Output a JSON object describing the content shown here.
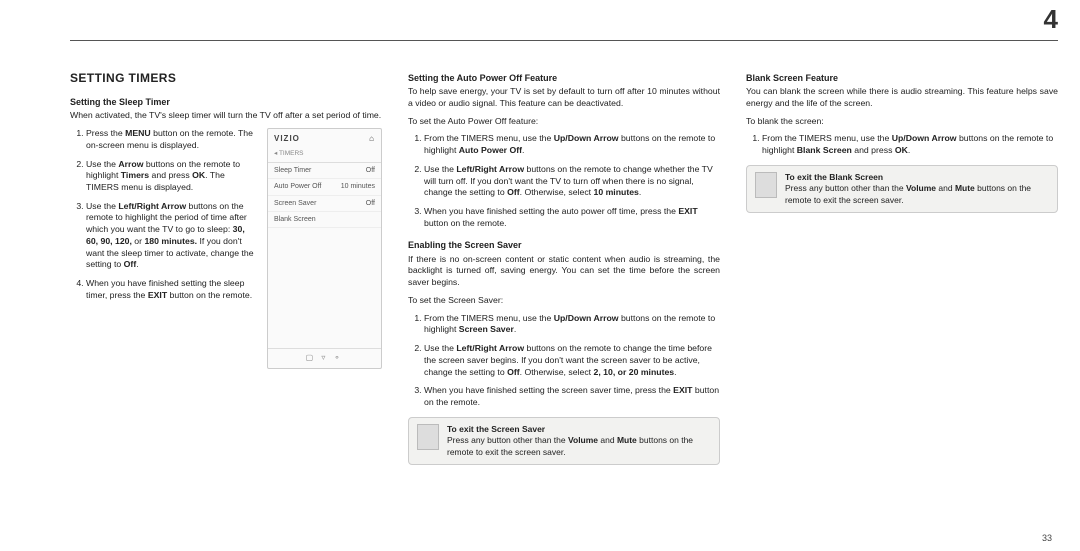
{
  "chapter_number": "4",
  "page_number": "33",
  "section_title": "SETTING TIMERS",
  "col1": {
    "h1": "Setting the Sleep Timer",
    "intro": "When activated, the TV's sleep timer will turn the TV off after a set period of time.",
    "s1a": "Press the ",
    "s1b": "MENU",
    "s1c": " button on the remote. The on-screen menu is displayed.",
    "s2a": "Use the ",
    "s2b": "Arrow",
    "s2c": " buttons on the remote to highlight ",
    "s2d": "Timers",
    "s2e": " and press ",
    "s2f": "OK",
    "s2g": ". The TIMERS menu is displayed.",
    "s3a": "Use the ",
    "s3b": "Left/Right Arrow",
    "s3c": " buttons on the remote to highlight the period of time after which you want the TV to go to sleep: ",
    "s3d": "30, 60, 90, 120,",
    "s3e": " or ",
    "s3f": "180 minutes.",
    "s3g": " If you don't want the sleep timer to activate, change the setting to ",
    "s3h": "Off",
    "s3i": ".",
    "s4a": "When you have finished setting the sleep timer, press the ",
    "s4b": "EXIT",
    "s4c": " button on the remote."
  },
  "osd": {
    "brand": "VIZIO",
    "menu_label": "TIMERS",
    "rows": [
      {
        "label": "Sleep Timer",
        "value": "Off"
      },
      {
        "label": "Auto Power Off",
        "value": "10 minutes"
      },
      {
        "label": "Screen Saver",
        "value": "Off"
      },
      {
        "label": "Blank Screen",
        "value": ""
      }
    ],
    "foot": "▢  ▿  ⚬"
  },
  "col2": {
    "hA": "Setting the Auto Power Off Feature",
    "pA": "To help save energy, your TV is set by default to turn off after 10 minutes without a video or audio signal. This feature can be deactivated.",
    "pA2": "To set the Auto Power Off feature:",
    "a1a": "From the TIMERS menu, use the ",
    "a1b": "Up/Down Arrow",
    "a1c": " buttons on the remote to highlight ",
    "a1d": "Auto Power Off",
    "a1e": ".",
    "a2a": "Use the ",
    "a2b": "Left/Right Arrow",
    "a2c": " buttons on the remote to change whether the TV will turn off. If you don't want the TV to turn off when there is no signal, change the setting to ",
    "a2d": "Off",
    "a2e": ". Otherwise, select ",
    "a2f": "10 minutes",
    "a2g": ".",
    "a3a": "When you have finished setting the auto power off time, press the ",
    "a3b": "EXIT",
    "a3c": " button on the remote.",
    "hB": "Enabling the Screen Saver",
    "pB": "If there is no on-screen content or static content when audio is streaming, the backlight is turned off, saving energy. You can set the time before the screen saver begins.",
    "pB2": "To set the Screen Saver:",
    "b1a": "From the TIMERS menu, use the ",
    "b1b": "Up/Down Arrow",
    "b1c": " buttons on the remote to highlight ",
    "b1d": "Screen Saver",
    "b1e": ".",
    "b2a": "Use the ",
    "b2b": "Left/Right Arrow",
    "b2c": " buttons on the remote to change the time before the screen saver begins. If you don't want the screen saver to be active, change the setting to ",
    "b2d": "Off",
    "b2e": ". Otherwise, select ",
    "b2f": "2, 10, or 20 minutes",
    "b2g": ".",
    "b3a": "When you have finished setting the screen saver time, press the ",
    "b3b": "EXIT",
    "b3c": " button on the remote.",
    "note_h": "To exit the Screen Saver",
    "note_a": "Press any button other than the ",
    "note_b": "Volume",
    "note_c": " and ",
    "note_d": "Mute",
    "note_e": " buttons on the remote to exit the screen saver."
  },
  "col3": {
    "hC": "Blank Screen Feature",
    "pC": "You can blank the screen while there is audio streaming. This feature helps save energy and the life of the screen.",
    "pC2": "To blank the screen:",
    "c1a": "From the TIMERS menu, use the ",
    "c1b": "Up/Down Arrow",
    "c1c": " buttons on the remote to highlight ",
    "c1d": "Blank Screen",
    "c1e": " and press ",
    "c1f": "OK",
    "c1g": ".",
    "note_h": "To exit the Blank Screen",
    "note_a": "Press any button other than the ",
    "note_b": "Volume",
    "note_c": " and ",
    "note_d": "Mute",
    "note_e": " buttons on the remote to exit the screen saver."
  }
}
